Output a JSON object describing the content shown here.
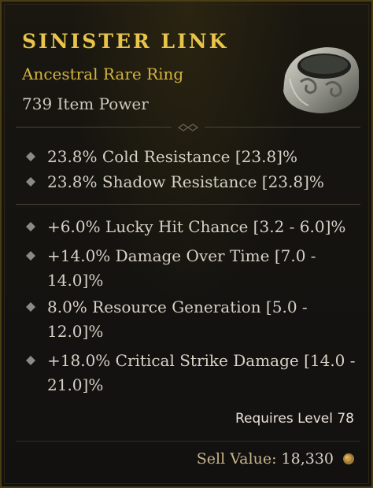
{
  "item": {
    "name": "SINISTER LINK",
    "type": "Ancestral Rare Ring",
    "power": "739 Item Power",
    "icon": "ring-icon"
  },
  "resistances": [
    {
      "line1": "23.8% Cold Resistance [23.8]%"
    },
    {
      "line1": "23.8% Shadow Resistance [23.8]%"
    }
  ],
  "affixes": [
    {
      "line1": "+6.0% Lucky Hit Chance [3.2 - 6.0]%"
    },
    {
      "line1": "+14.0% Damage Over Time [7.0 -",
      "line2": "14.0]%"
    },
    {
      "line1": "8.0% Resource Generation [5.0 -",
      "line2": "12.0]%"
    },
    {
      "line1": "+18.0% Critical Strike Damage [14.0 -",
      "line2": "21.0]%"
    }
  ],
  "requirement": "Requires Level 78",
  "sell": {
    "label": "Sell Value:",
    "value": "18,330",
    "icon": "gold-coin-icon"
  },
  "colors": {
    "title": "#e8c54a",
    "rarity": "#d3b43f",
    "text": "#d7d1c6"
  }
}
